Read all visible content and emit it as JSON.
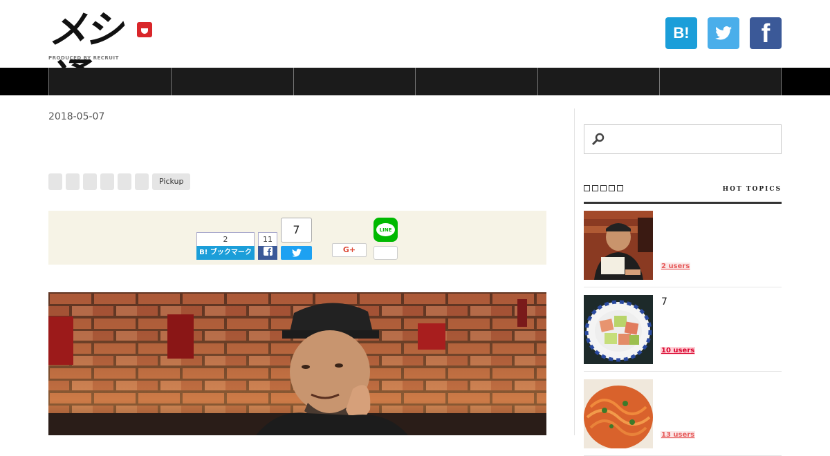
{
  "header": {
    "logo_text": "メシ通",
    "logo_sub": "PRODUCED BY RECRUIT",
    "social": {
      "hatena_label": "B!",
      "twitter_icon": "twitter-bird-icon",
      "facebook_label": "f"
    }
  },
  "nav": {
    "items": [
      "",
      "",
      "",
      "",
      "",
      "",
      ""
    ]
  },
  "article": {
    "date": "2018-05-07",
    "tags": [
      "",
      "",
      "",
      "",
      "",
      "",
      "Pickup"
    ],
    "share": {
      "hatena_count": "2",
      "hatena_label": "B! ブックマーク",
      "facebook_count": "11",
      "twitter_count": "7",
      "googleplus_label": "G+",
      "line_label": "LINE"
    }
  },
  "sidebar": {
    "search_placeholder": "",
    "hot_topics_heading": "HOT TOPICS",
    "topics": [
      {
        "title": "",
        "users": "2 users",
        "thumb": "man-with-card-photo"
      },
      {
        "title": "7",
        "users": "10 users",
        "thumb": "tuna-avocado-bowl-photo"
      },
      {
        "title": "",
        "users": "13 users",
        "thumb": "spaghetti-napolitan-photo"
      }
    ]
  },
  "colors": {
    "hatena": "#1b9ed9",
    "twitter": "#4aaeea",
    "facebook": "#3b5998",
    "nav_bg": "#1b1b1b",
    "share_bg": "#f6f3e6",
    "users_red": "#e65a5a"
  }
}
